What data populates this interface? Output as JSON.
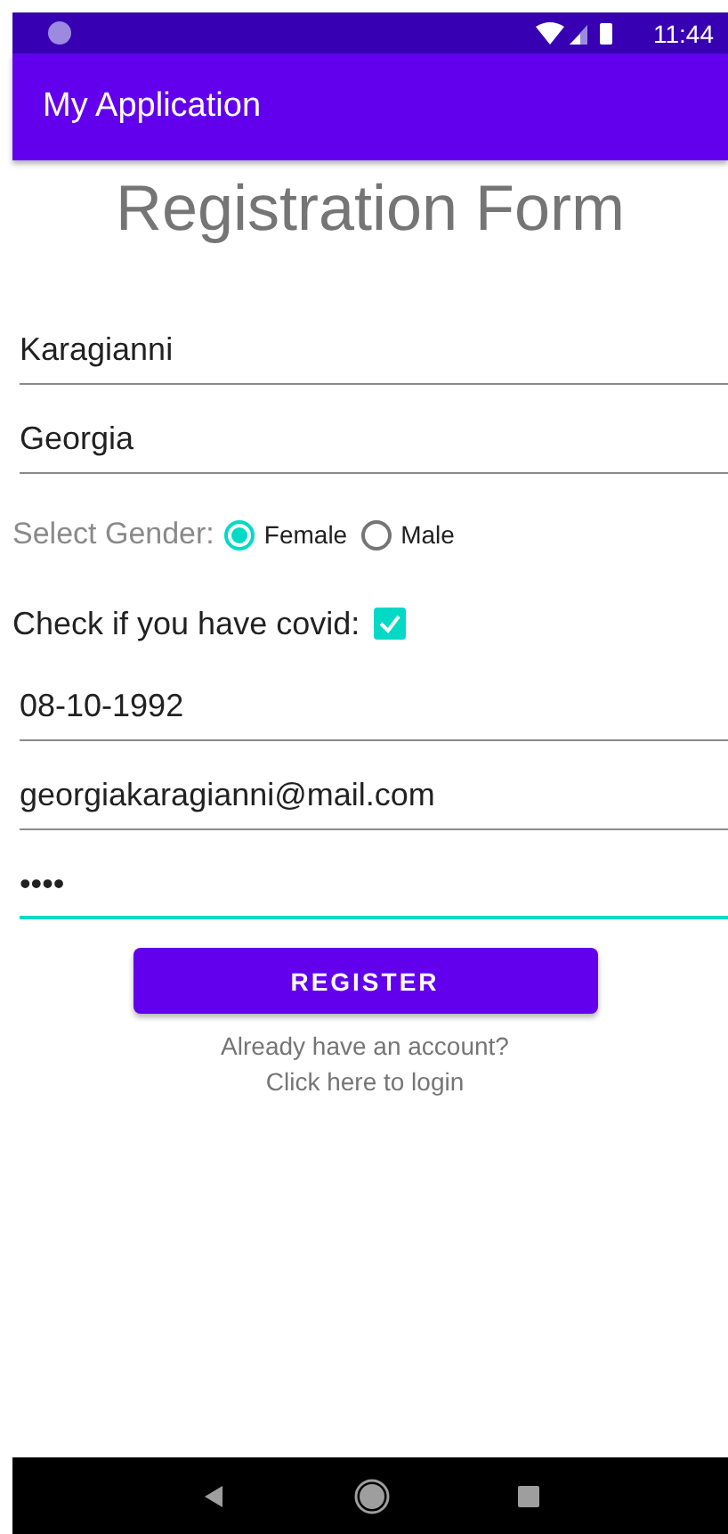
{
  "status_bar": {
    "time": "11:44"
  },
  "app_bar": {
    "title": "My Application"
  },
  "form": {
    "heading": "Registration Form",
    "fields_top": [
      {
        "value": "Karagianni",
        "focused": false
      },
      {
        "value": "Georgia",
        "focused": false
      }
    ],
    "gender": {
      "label": "Select Gender:",
      "options": [
        {
          "label": "Female",
          "selected": true
        },
        {
          "label": "Male",
          "selected": false
        }
      ]
    },
    "covid": {
      "label": "Check if you have covid:",
      "checked": true
    },
    "fields_bottom": [
      {
        "value": "08-10-1992",
        "focused": false
      },
      {
        "value": "georgiakaragianni@mail.com",
        "focused": false
      },
      {
        "value": "••••",
        "focused": true
      }
    ],
    "register_button": "REGISTER",
    "login_prompt": "Already have an account?",
    "login_link": "Click here to login"
  }
}
